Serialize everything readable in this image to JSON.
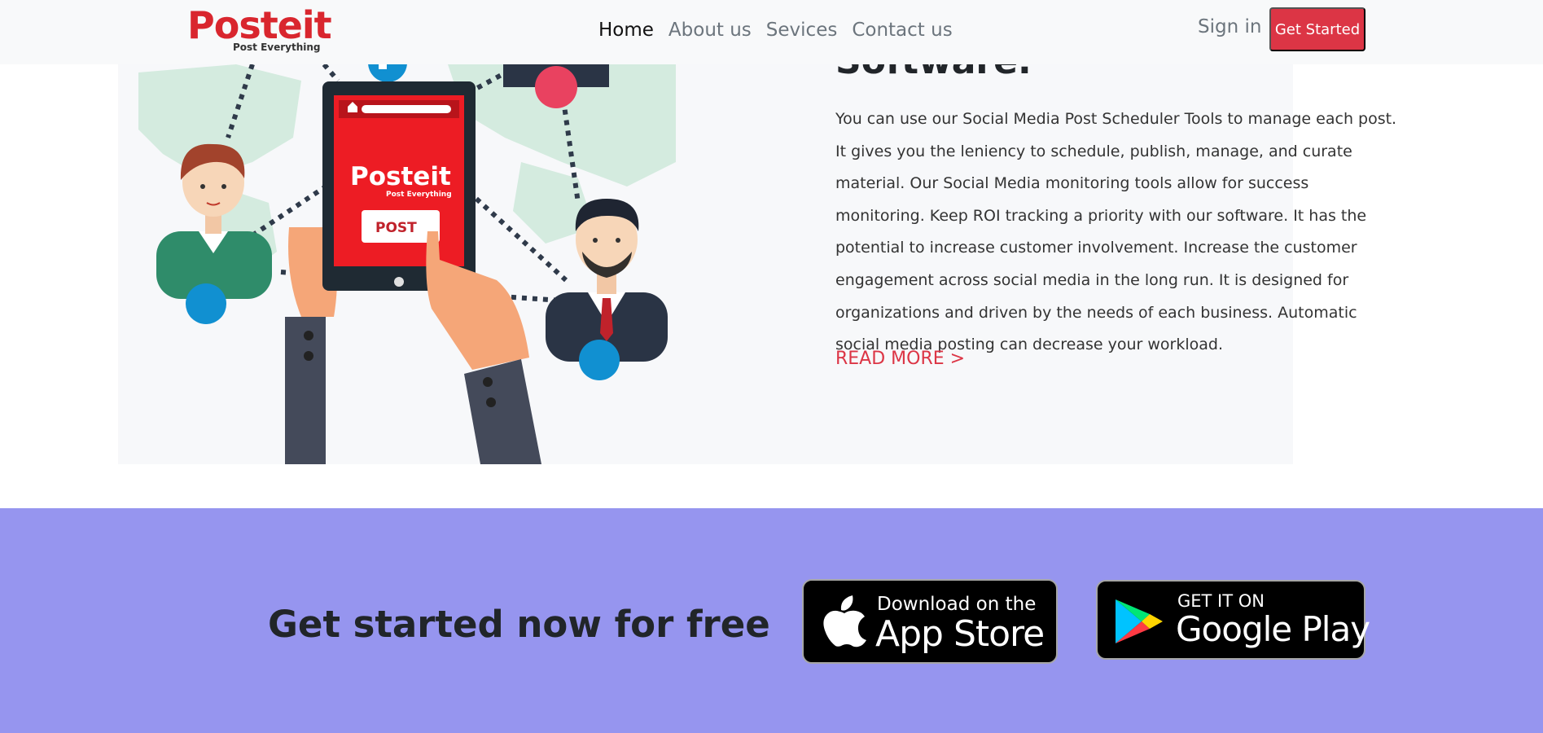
{
  "navbar": {
    "logo_text": "Posteit",
    "logo_tagline": "Post Everything",
    "links": [
      "Home",
      "About us",
      "Sevices",
      "Contact us"
    ],
    "sign_in": "Sign in",
    "get_started": "Get Started"
  },
  "feature": {
    "heading": "Software.",
    "body": "You can use our Social Media Post Scheduler Tools to manage each post. It gives you the leniency to schedule, publish, manage, and curate material. Our Social Media monitoring tools allow for success monitoring. Keep ROI tracking a priority with our software. It has the potential to increase customer involvement. Increase the customer engagement across social media in the long run. It is designed for organizations and driven by the needs of each business. Automatic social media posting can decrease your workload.",
    "read_more": "READ MORE >",
    "illustration": {
      "tablet_logo": "Posteit",
      "tablet_tagline": "Post Everything",
      "tablet_button": "POST"
    }
  },
  "cta": {
    "heading": "Get started now for free",
    "app_store": {
      "line1": "Download on the",
      "line2": "App Store"
    },
    "google_play": {
      "line1": "GET IT ON",
      "line2": "Google Play"
    }
  },
  "colors": {
    "accent": "#dc3545",
    "cta_background": "#9695ef",
    "navbar_background": "#f8f9fa"
  }
}
